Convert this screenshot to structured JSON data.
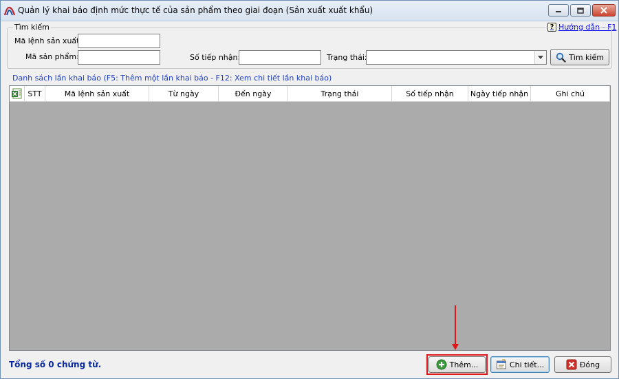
{
  "window": {
    "title": "Quản lý khai báo định mức thực tế của sản phẩm theo giai đoạn (Sản xuất xuất khẩu)",
    "help_link": "Hướng dẫn - F1"
  },
  "search": {
    "group_title": "Tìm kiếm",
    "production_order_label": "Mã lệnh sản xuất:",
    "production_order_value": "",
    "product_code_label": "Mã sản phẩm:",
    "product_code_value": "",
    "receipt_number_label": "Số tiếp nhận:",
    "receipt_number_value": "",
    "status_label": "Trạng thái:",
    "status_value": "",
    "search_button": "Tìm kiếm"
  },
  "list": {
    "title": "Danh sách lần khai báo (F5: Thêm một lần khai báo - F12: Xem chi tiết lần khai báo)",
    "columns": [
      "STT",
      "Mã lệnh sản xuất",
      "Từ ngày",
      "Đến ngày",
      "Trạng thái",
      "Số tiếp nhận",
      "Ngày tiếp nhận",
      "Ghi chú"
    ],
    "rows": []
  },
  "footer": {
    "total_text": "Tổng số 0 chứng từ.",
    "add_button": "Thêm...",
    "detail_button": "Chi tiết...",
    "close_button": "Đóng"
  },
  "colors": {
    "accent_blue": "#1f3fbf",
    "total_text": "#0a2a9e",
    "highlight_red": "#e0161b"
  },
  "icons": {
    "app": "app-logo-icon",
    "minimize": "minimize-icon",
    "maximize": "maximize-icon",
    "close": "close-icon",
    "help": "help-icon",
    "search": "magnifier-icon",
    "excel": "excel-export-icon",
    "add": "add-plus-icon",
    "detail": "detail-form-icon",
    "close_form": "close-x-icon",
    "dropdown": "chevron-down-icon"
  }
}
